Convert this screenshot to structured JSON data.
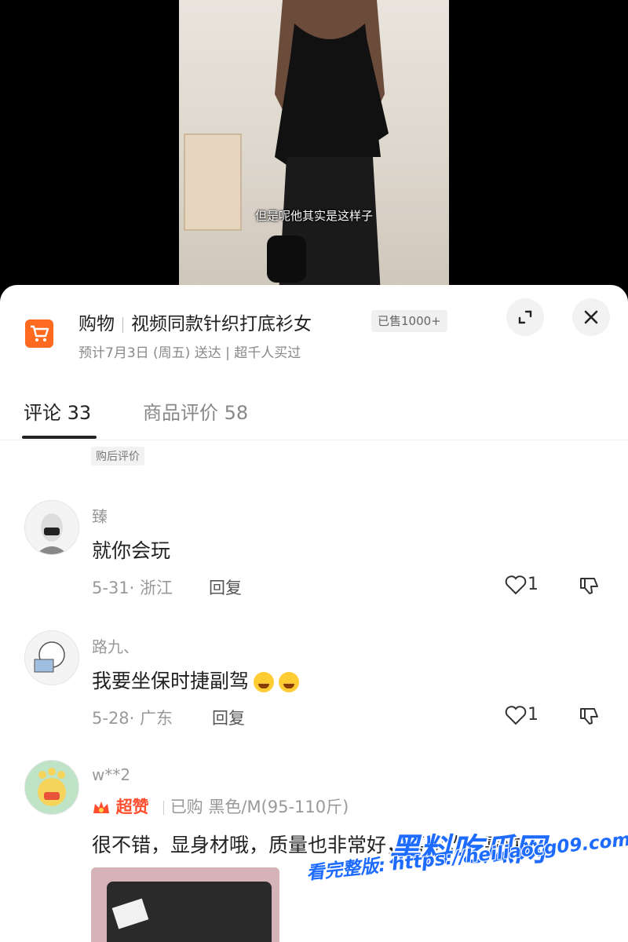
{
  "video": {
    "subtitle": "但是呢他其实是这样子"
  },
  "product": {
    "category": "购物",
    "name": "视频同款针织打底衫女",
    "sold_badge": "已售1000+",
    "delivery": "预计7月3日 (周五) 送达 | 超千人买过",
    "icon": "shopping-cart-icon"
  },
  "tabs": {
    "comments": "评论 33",
    "reviews": "商品评价 58"
  },
  "section_tag": "购后评价",
  "comments": [
    {
      "user": "臻",
      "text": "就你会玩",
      "date_location": "5-31· 浙江",
      "reply": "回复",
      "likes": "1"
    },
    {
      "user": "路九、",
      "text": "我要坐保时捷副驾",
      "date_location": "5-28· 广东",
      "reply": "回复",
      "likes": "1",
      "emoji_count": 2
    },
    {
      "user": "w**2",
      "badge": "超赞",
      "purchase": "已购 黑色/M(95-110斤)",
      "text": "很不错，显身材哦，质量也非常好，喜欢欢欢喜欢哈"
    }
  ],
  "watermark": {
    "brand": "黑料吃瓜网",
    "url_line": "看完整版: https://heiliaocg09.com"
  }
}
